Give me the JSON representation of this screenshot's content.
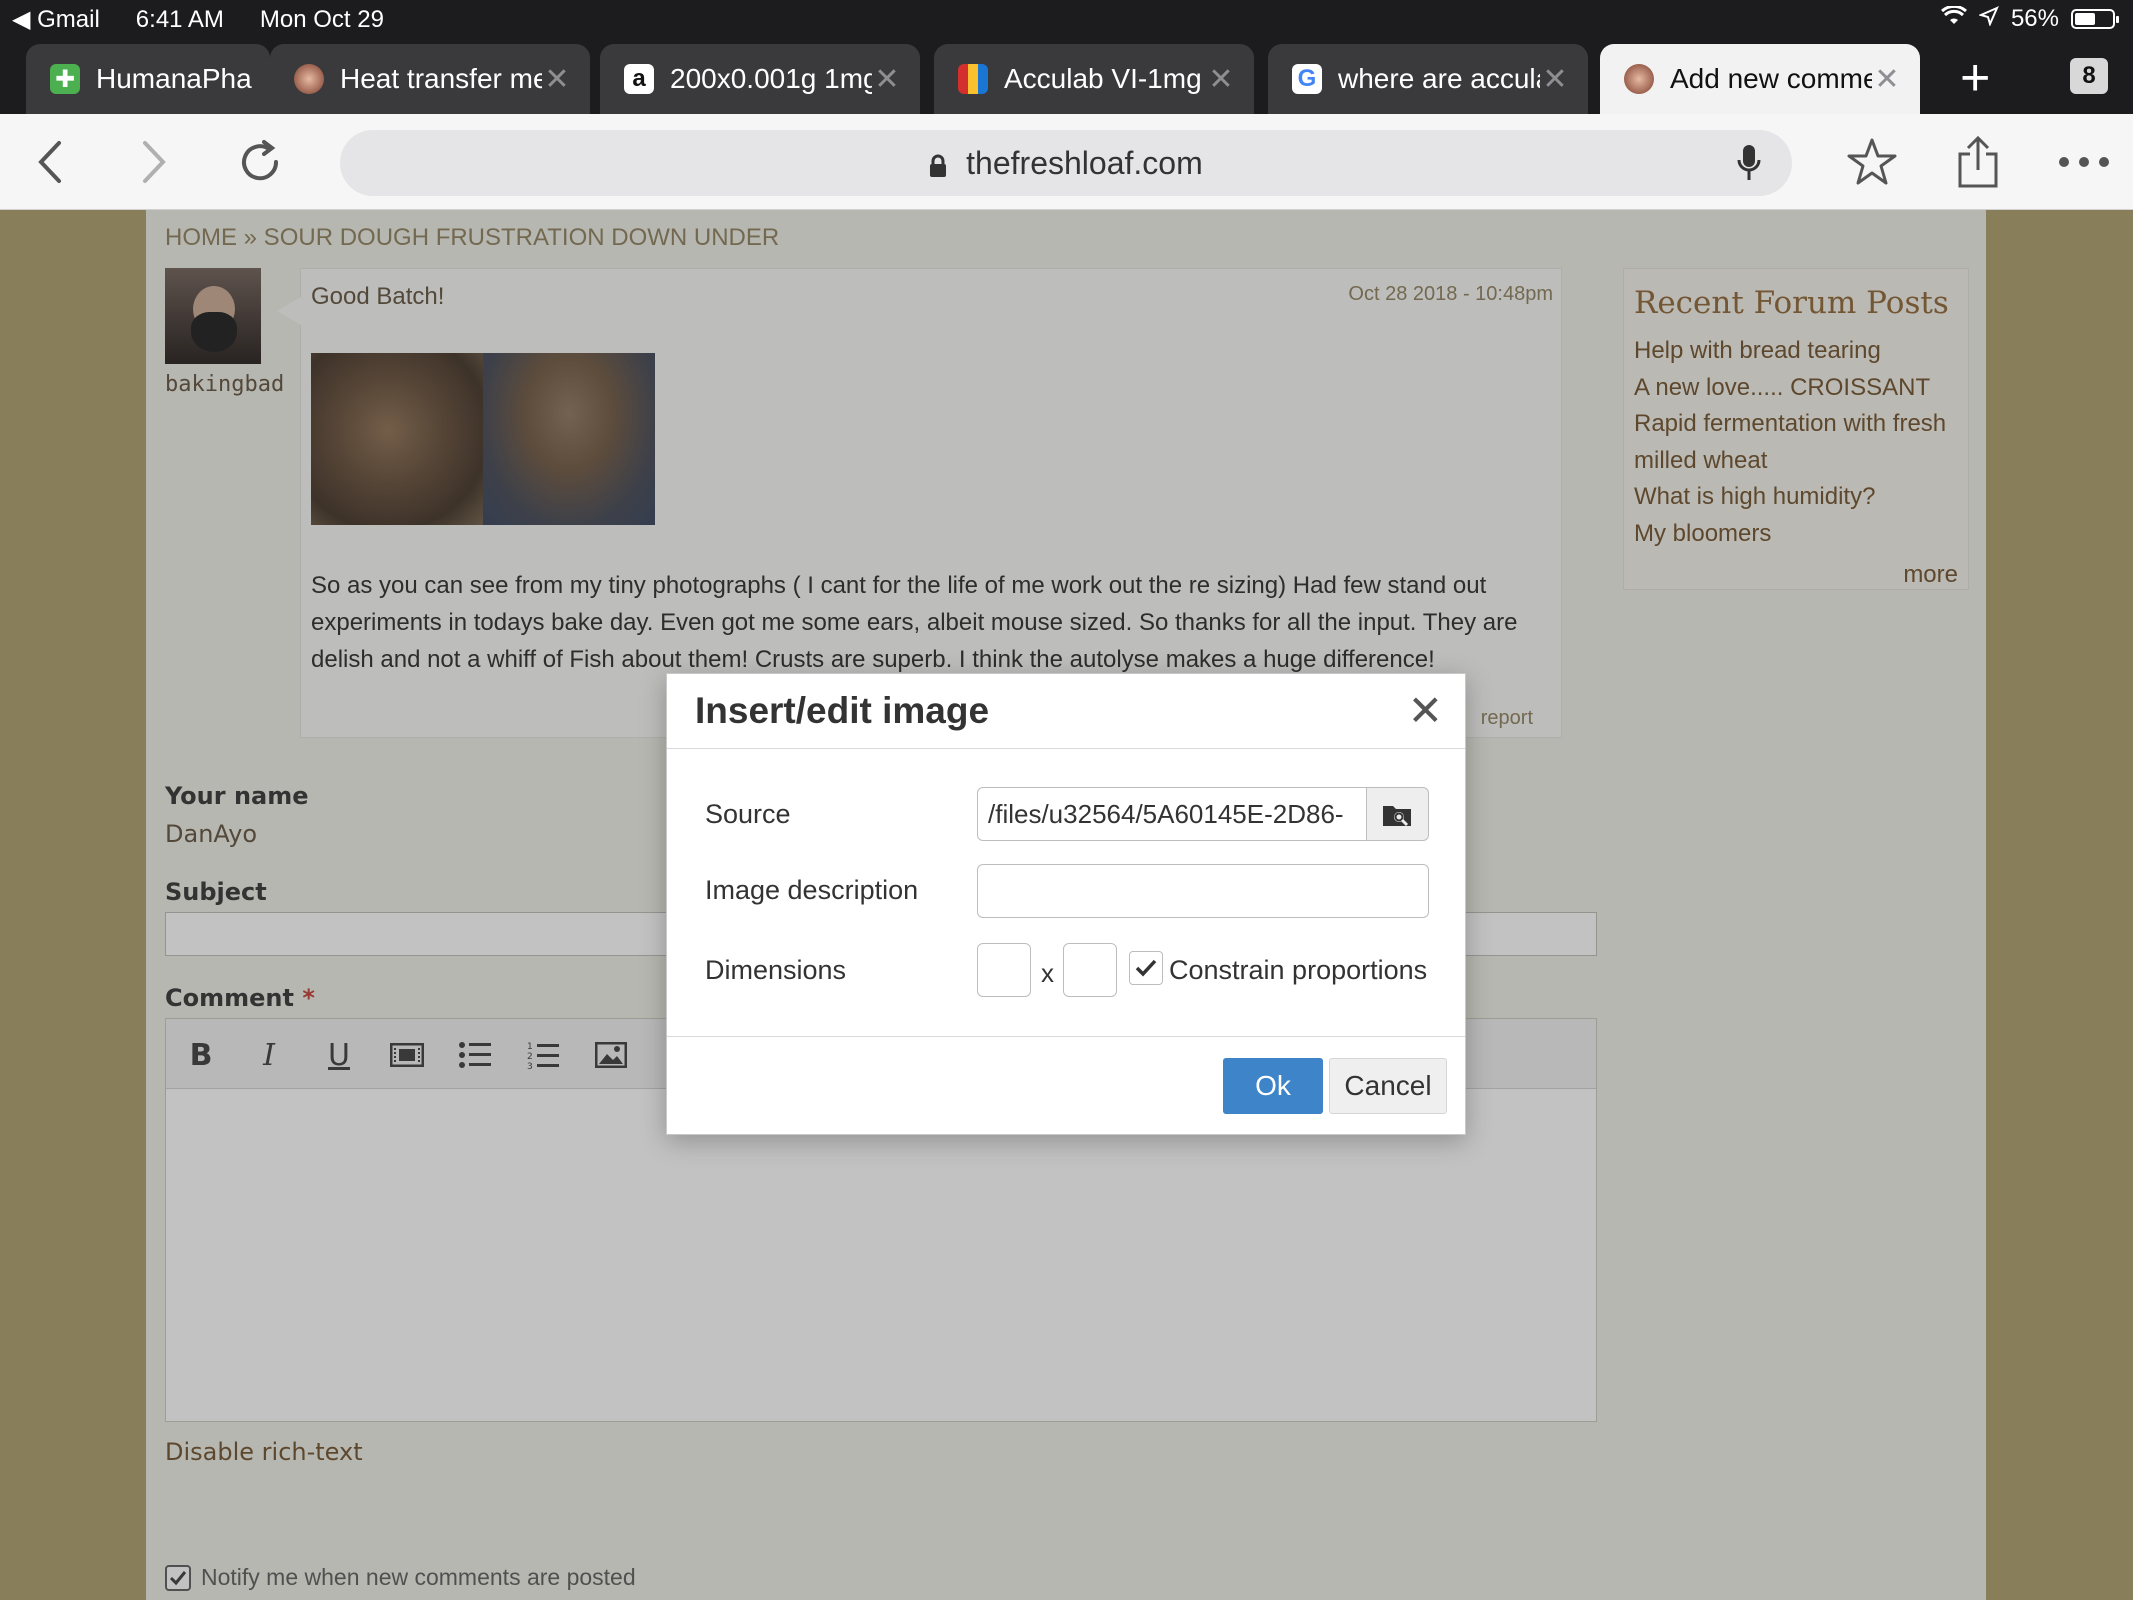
{
  "status_bar": {
    "back_app": "Gmail",
    "time": "6:41 AM",
    "date": "Mon Oct 29",
    "battery": "56%",
    "battery_level": 0.56
  },
  "tabs": [
    {
      "title": "HumanaPha",
      "favicon": "pill-icon",
      "active": false
    },
    {
      "title": "Heat transfer me",
      "favicon": "freshloaf-icon",
      "active": false
    },
    {
      "title": "200x0.001g 1mg",
      "favicon": "amazon-icon",
      "active": false
    },
    {
      "title": "Acculab VI-1mg",
      "favicon": "briefcase-icon",
      "active": false
    },
    {
      "title": "where are accula",
      "favicon": "google-icon",
      "active": false
    },
    {
      "title": "Add new comme",
      "favicon": "freshloaf-icon",
      "active": true
    }
  ],
  "tab_count": "8",
  "url": "thefreshloaf.com",
  "breadcrumb": "HOME » SOUR DOUGH FRUSTRATION DOWN UNDER",
  "post": {
    "author": "bakingbad",
    "subject": "Good Batch!",
    "date": "Oct 28 2018 - 10:48pm",
    "body": "So as you can see from my tiny photographs ( I cant for the life of me work out the re sizing) Had few stand out experiments in todays bake day. Even got me some ears, albeit mouse sized. So thanks for all the input. They are delish and not a whiff of Fish about them! Crusts are superb. I think the autolyse  makes a huge difference!",
    "report_label": "report"
  },
  "sidebar": {
    "title": "Recent Forum Posts",
    "items": [
      "Help with bread tearing",
      "A new love..... CROISSANT",
      "Rapid fermentation with fresh milled wheat",
      "What is high humidity?",
      "My bloomers"
    ],
    "more_label": "more"
  },
  "form": {
    "name_label": "Your name",
    "name_value": "DanAyo",
    "subject_label": "Subject",
    "comment_label": "Comment",
    "required_mark": "*",
    "disable_rich_text": "Disable rich-text",
    "notify_label": "Notify me when new comments are posted",
    "notify_checked": true
  },
  "dialog": {
    "title": "Insert/edit image",
    "source_label": "Source",
    "source_value": "/files/u32564/5A60145E-2D86-",
    "description_label": "Image description",
    "description_value": "",
    "dimensions_label": "Dimensions",
    "width_value": "",
    "height_value": "",
    "dim_separator": "x",
    "constrain_label": "Constrain proportions",
    "constrain_checked": true,
    "ok_label": "Ok",
    "cancel_label": "Cancel"
  },
  "colors": {
    "page_bg": "#aa9a64",
    "ok_button": "#3d84c8",
    "required": "#c0332b"
  }
}
